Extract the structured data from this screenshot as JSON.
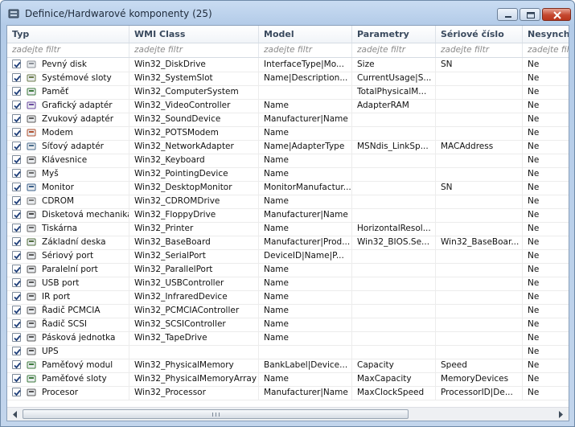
{
  "window": {
    "title": "Definice/Hardwarové komponenty (25)",
    "controls": {
      "minimize": "minimize",
      "maximize": "maximize",
      "close": "close"
    }
  },
  "table": {
    "columns": [
      {
        "key": "typ",
        "label": "Typ",
        "filter": "zadejte filtr"
      },
      {
        "key": "wmi",
        "label": "WMI Class",
        "filter": "zadejte filtr"
      },
      {
        "key": "model",
        "label": "Model",
        "filter": "zadejte filtr"
      },
      {
        "key": "param",
        "label": "Parametry",
        "filter": "zadejte filtr"
      },
      {
        "key": "serial",
        "label": "Sériové číslo",
        "filter": "zadejte filtr"
      },
      {
        "key": "nesync",
        "label": "Nesynchro",
        "filter": "zadejte filtr"
      }
    ],
    "rows": [
      {
        "icon": "hard-disk-icon",
        "checked": true,
        "typ": "Pevný disk",
        "wmi": "Win32_DiskDrive",
        "model": "InterfaceType|Mo...",
        "param": "Size",
        "serial": "SN",
        "nesync": "Ne"
      },
      {
        "icon": "system-slot-icon",
        "checked": true,
        "typ": "Systémové sloty",
        "wmi": "Win32_SystemSlot",
        "model": "Name|Description...",
        "param": "CurrentUsage|S...",
        "serial": "",
        "nesync": "Ne"
      },
      {
        "icon": "memory-icon",
        "checked": true,
        "typ": "Paměť",
        "wmi": "Win32_ComputerSystem",
        "model": "",
        "param": "TotalPhysicalM...",
        "serial": "",
        "nesync": "Ne"
      },
      {
        "icon": "graphics-adapter-icon",
        "checked": true,
        "typ": "Grafický adaptér",
        "wmi": "Win32_VideoController",
        "model": "Name",
        "param": "AdapterRAM",
        "serial": "",
        "nesync": "Ne"
      },
      {
        "icon": "sound-device-icon",
        "checked": true,
        "typ": "Zvukový adaptér",
        "wmi": "Win32_SoundDevice",
        "model": "Manufacturer|Name",
        "param": "",
        "serial": "",
        "nesync": "Ne"
      },
      {
        "icon": "modem-icon",
        "checked": true,
        "typ": "Modem",
        "wmi": "Win32_POTSModem",
        "model": "Name",
        "param": "",
        "serial": "",
        "nesync": "Ne"
      },
      {
        "icon": "network-adapter-icon",
        "checked": true,
        "typ": "Síťový adaptér",
        "wmi": "Win32_NetworkAdapter",
        "model": "Name|AdapterType",
        "param": "MSNdis_LinkSp...",
        "serial": "MACAddress",
        "nesync": "Ne"
      },
      {
        "icon": "keyboard-icon",
        "checked": true,
        "typ": "Klávesnice",
        "wmi": "Win32_Keyboard",
        "model": "Name",
        "param": "",
        "serial": "",
        "nesync": "Ne"
      },
      {
        "icon": "mouse-icon",
        "checked": true,
        "typ": "Myš",
        "wmi": "Win32_PointingDevice",
        "model": "Name",
        "param": "",
        "serial": "",
        "nesync": "Ne"
      },
      {
        "icon": "monitor-icon",
        "checked": true,
        "typ": "Monitor",
        "wmi": "Win32_DesktopMonitor",
        "model": "MonitorManufactur...",
        "param": "",
        "serial": "SN",
        "nesync": "Ne"
      },
      {
        "icon": "cdrom-icon",
        "checked": true,
        "typ": "CDROM",
        "wmi": "Win32_CDROMDrive",
        "model": "Name",
        "param": "",
        "serial": "",
        "nesync": "Ne"
      },
      {
        "icon": "floppy-drive-icon",
        "checked": true,
        "typ": "Disketová mechanika",
        "wmi": "Win32_FloppyDrive",
        "model": "Manufacturer|Name",
        "param": "",
        "serial": "",
        "nesync": "Ne"
      },
      {
        "icon": "printer-icon",
        "checked": true,
        "typ": "Tiskárna",
        "wmi": "Win32_Printer",
        "model": "Name",
        "param": "HorizontalResol...",
        "serial": "",
        "nesync": "Ne"
      },
      {
        "icon": "motherboard-icon",
        "checked": true,
        "typ": "Základní deska",
        "wmi": "Win32_BaseBoard",
        "model": "Manufacturer|Prod...",
        "param": "Win32_BIOS.Se...",
        "serial": "Win32_BaseBoar...",
        "nesync": "Ne"
      },
      {
        "icon": "port-icon",
        "checked": true,
        "typ": "Sériový port",
        "wmi": "Win32_SerialPort",
        "model": "DeviceID|Name|P...",
        "param": "",
        "serial": "",
        "nesync": "Ne"
      },
      {
        "icon": "port-icon",
        "checked": true,
        "typ": "Paralelní port",
        "wmi": "Win32_ParallelPort",
        "model": "Name",
        "param": "",
        "serial": "",
        "nesync": "Ne"
      },
      {
        "icon": "port-icon",
        "checked": true,
        "typ": "USB port",
        "wmi": "Win32_USBController",
        "model": "Name",
        "param": "",
        "serial": "",
        "nesync": "Ne"
      },
      {
        "icon": "port-icon",
        "checked": true,
        "typ": "IR port",
        "wmi": "Win32_InfraredDevice",
        "model": "Name",
        "param": "",
        "serial": "",
        "nesync": "Ne"
      },
      {
        "icon": "controller-icon",
        "checked": true,
        "typ": "Řadič PCMCIA",
        "wmi": "Win32_PCMCIAController",
        "model": "Name",
        "param": "",
        "serial": "",
        "nesync": "Ne"
      },
      {
        "icon": "controller-icon",
        "checked": true,
        "typ": "Řadič SCSI",
        "wmi": "Win32_SCSIController",
        "model": "Name",
        "param": "",
        "serial": "",
        "nesync": "Ne"
      },
      {
        "icon": "tape-drive-icon",
        "checked": true,
        "typ": "Pásková jednotka",
        "wmi": "Win32_TapeDrive",
        "model": "Name",
        "param": "",
        "serial": "",
        "nesync": "Ne"
      },
      {
        "icon": "ups-icon",
        "checked": true,
        "typ": "UPS",
        "wmi": "",
        "model": "",
        "param": "",
        "serial": "",
        "nesync": "Ne"
      },
      {
        "icon": "memory-module-icon",
        "checked": true,
        "typ": "Paměťový modul",
        "wmi": "Win32_PhysicalMemory",
        "model": "BankLabel|Device...",
        "param": "Capacity",
        "serial": "Speed",
        "nesync": "Ne"
      },
      {
        "icon": "memory-slot-icon",
        "checked": true,
        "typ": "Paměťové sloty",
        "wmi": "Win32_PhysicalMemoryArray",
        "model": "Name",
        "param": "MaxCapacity",
        "serial": "MemoryDevices",
        "nesync": "Ne"
      },
      {
        "icon": "processor-icon",
        "checked": true,
        "typ": "Procesor",
        "wmi": "Win32_Processor",
        "model": "Manufacturer|Name",
        "param": "MaxClockSpeed",
        "serial": "ProcessorID|De...",
        "nesync": "Ne"
      }
    ]
  },
  "scrollbar": {
    "grip": "III",
    "position": 0
  }
}
